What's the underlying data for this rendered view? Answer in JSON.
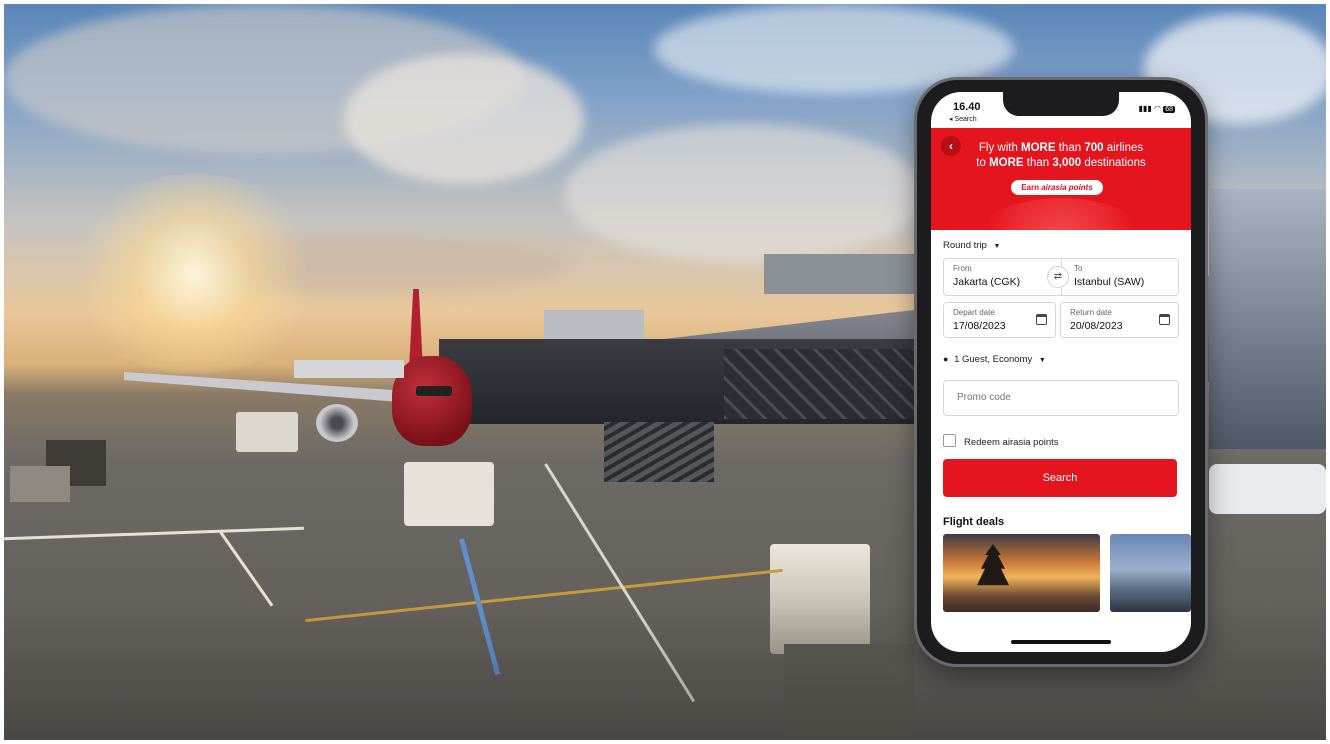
{
  "phone": {
    "status_bar": {
      "time": "16.40",
      "back_label": "◂ Search",
      "battery": "68"
    },
    "banner": {
      "line1_prefix": "Fly with ",
      "line1_bold1": "MORE",
      "line1_mid": " than ",
      "line1_bold2": "700",
      "line1_suffix": " airlines",
      "line2_prefix": "to ",
      "line2_bold1": "MORE",
      "line2_mid": " than ",
      "line2_bold2": "3,000",
      "line2_suffix": " destinations",
      "earn_prefix": "Earn ",
      "earn_italic": "airasia points",
      "back_icon": "‹",
      "accent_color": "#e4151f"
    },
    "form": {
      "trip_type": "Round trip",
      "from_label": "From",
      "from_value": "Jakarta (CGK)",
      "to_label": "To",
      "to_value": "Istanbul (SAW)",
      "swap_icon": "⇄",
      "depart_label": "Depart date",
      "depart_value": "17/08/2023",
      "return_label": "Return date",
      "return_value": "20/08/2023",
      "guests": "1 Guest, Economy",
      "promo_placeholder": "Promo code",
      "redeem_label": "Redeem airasia points",
      "search_button": "Search"
    },
    "deals": {
      "title": "Flight deals"
    }
  }
}
